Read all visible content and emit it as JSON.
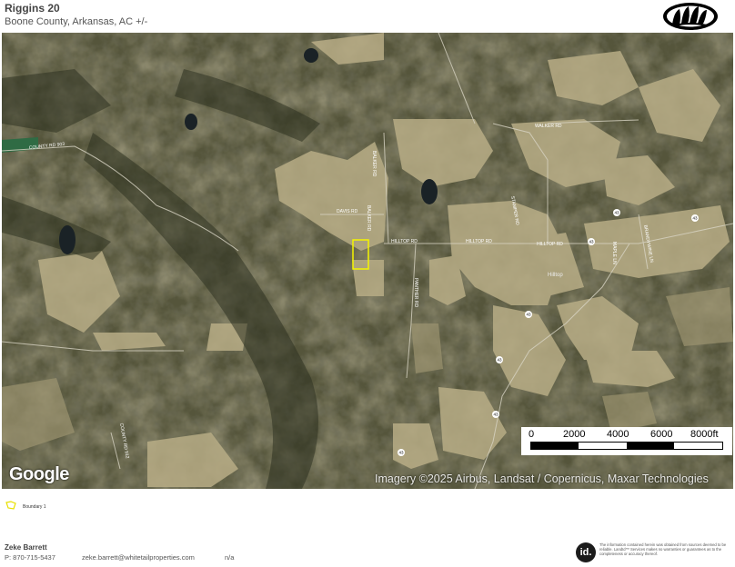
{
  "header": {
    "title": "Riggins 20",
    "subtitle": "Boone County, Arkansas,  AC +/-"
  },
  "map": {
    "attribution_logo": "Google",
    "imagery_credit": "Imagery ©2025 Airbus, Landsat / Copernicus, Maxar Technologies",
    "scale_labels": [
      "0",
      "2000",
      "4000",
      "6000",
      "8000ft"
    ],
    "road_labels": [
      "COUNTY RD 903",
      "WALKER RD",
      "HILLTOP RD",
      "HILLTOP RD",
      "HILLTOP RD",
      "DAVIS RD",
      "BALKER RD",
      "BALKER RD",
      "PANTHER RD",
      "COUNTY RD 912",
      "STAMPER RD",
      "MAPLE LN",
      "BRANDYWINE LN",
      "Hilltop"
    ],
    "highway_shields": [
      "43",
      "43",
      "43",
      "43",
      "43",
      "43",
      "43"
    ],
    "boundary_color": "#f5f500"
  },
  "legend": {
    "items": [
      {
        "label": "Boundary 1",
        "color": "#f5f500",
        "icon": "boundary-outline-icon"
      }
    ]
  },
  "agent": {
    "name": "Zeke Barrett",
    "phone": "P: 870-715-5437",
    "email": "zeke.barrett@whitetailproperties.com",
    "extra": "n/a"
  },
  "footer": {
    "badge": "id.",
    "disclaimer": "The information contained herein was obtained from sources deemed to be reliable. LandId™ Services makes no warranties or guarantees as to the completeness or accuracy thereof."
  },
  "brand": {
    "logo_icon": "whitetail-paw-logo-icon"
  }
}
